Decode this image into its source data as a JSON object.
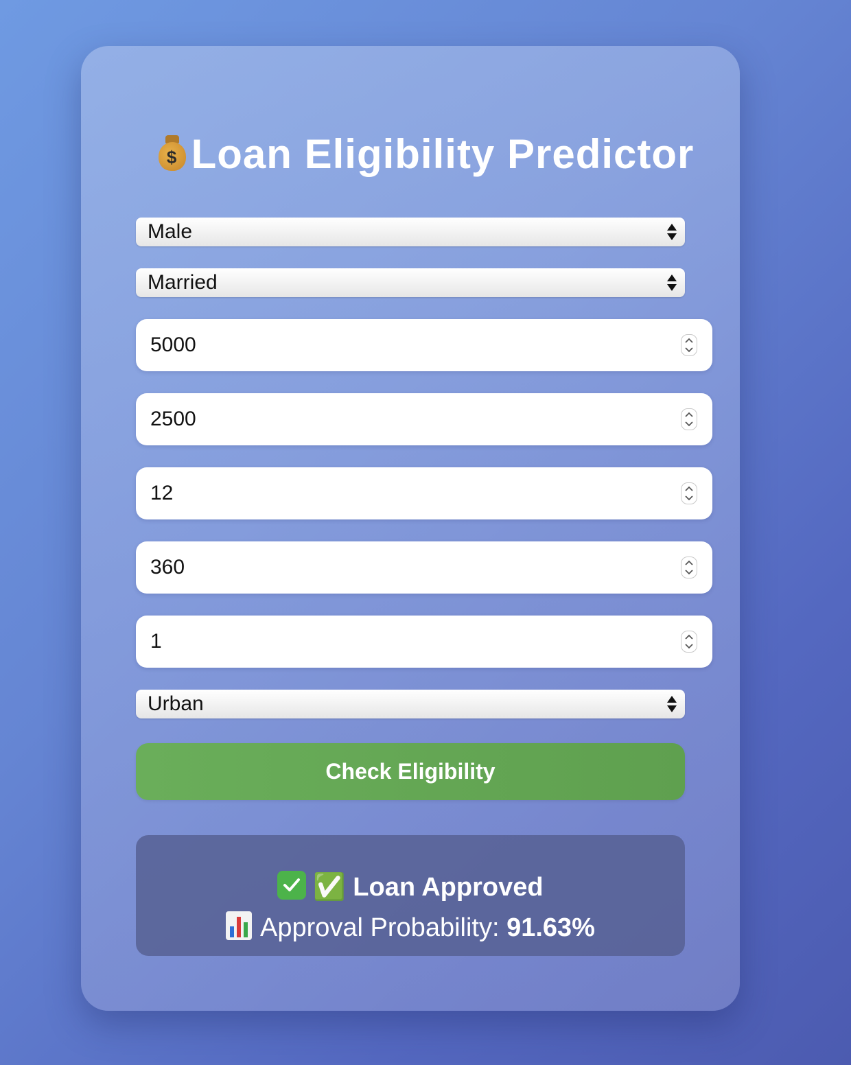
{
  "app": {
    "title": "Loan Eligibility Predictor"
  },
  "form": {
    "gender": {
      "selected": "Male"
    },
    "married": {
      "selected": "Married"
    },
    "applicant_income": {
      "value": "5000"
    },
    "coapplicant_income": {
      "value": "2500"
    },
    "loan_amount": {
      "value": "12"
    },
    "loan_term": {
      "value": "360"
    },
    "credit_history": {
      "value": "1"
    },
    "property_area": {
      "selected": "Urban"
    },
    "submit_label": "Check Eligibility"
  },
  "result": {
    "status": "✅ Loan Approved",
    "probability_label": "Approval Probability: ",
    "probability_value": "91.63%"
  },
  "colors": {
    "button": "#62a552",
    "result_bg": "#555f91",
    "check": "#4cb34a"
  }
}
